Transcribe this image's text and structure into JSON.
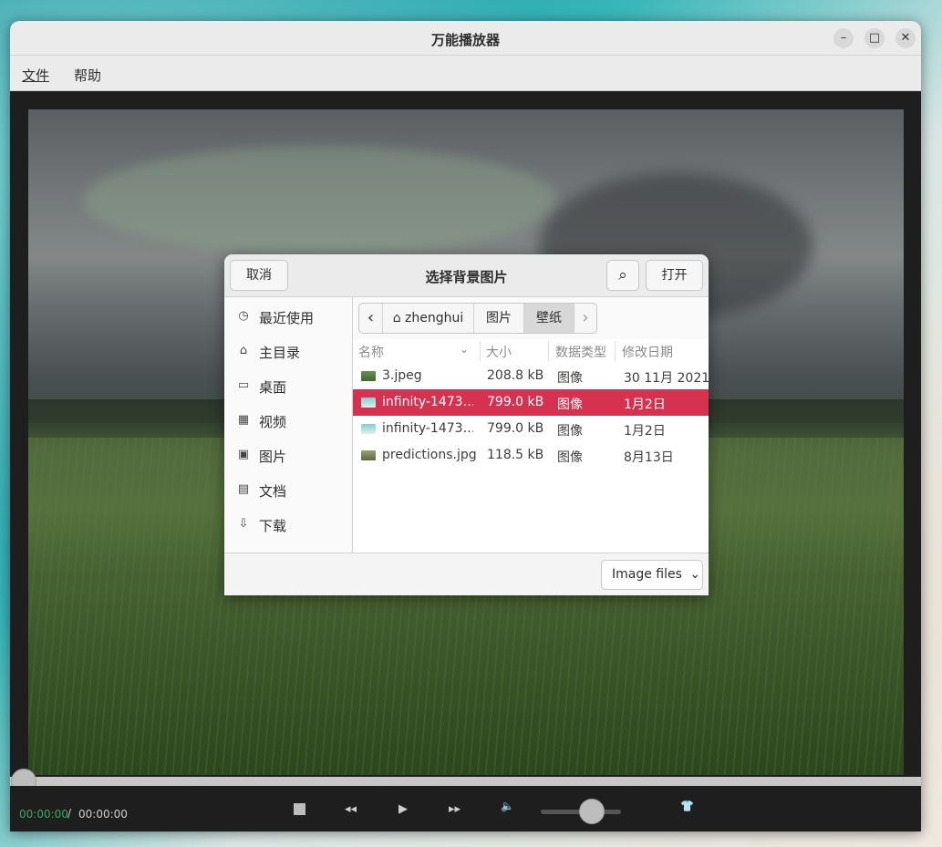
{
  "window": {
    "title": "万能播放器",
    "controls": {
      "minimize": "–",
      "maximize": "□",
      "close": "✕"
    }
  },
  "menu": {
    "file": "文件",
    "help": "帮助"
  },
  "player": {
    "current_time": "00:00:00",
    "separator": "/",
    "total_time": "00:00:00",
    "seek_fraction": 0.0,
    "volume_fraction": 0.5,
    "icons": {
      "stop": "stop-icon",
      "rewind": "rewind-icon",
      "play": "play-icon",
      "forward": "fast-forward-icon",
      "volume": "speaker-icon",
      "skin": "shirt-icon"
    },
    "glyphs": {
      "rewind": "◂◂",
      "play": "▶",
      "forward": "▸▸",
      "volume": "🔈",
      "skin": "👕"
    }
  },
  "dialog": {
    "title": "选择背景图片",
    "cancel_label": "取消",
    "open_label": "打开",
    "search_glyph": "⌕",
    "places": [
      {
        "label": "最近使用",
        "icon": "clock-icon",
        "glyph": "◷"
      },
      {
        "label": "主目录",
        "icon": "home-icon",
        "glyph": "⌂"
      },
      {
        "label": "桌面",
        "icon": "desktop-icon",
        "glyph": "▭"
      },
      {
        "label": "视频",
        "icon": "film-icon",
        "glyph": "▦"
      },
      {
        "label": "图片",
        "icon": "image-icon",
        "glyph": "▣"
      },
      {
        "label": "文档",
        "icon": "document-icon",
        "glyph": "▤"
      },
      {
        "label": "下载",
        "icon": "download-icon",
        "glyph": "⇩"
      }
    ],
    "path": {
      "back_glyph": "‹",
      "forward_glyph": "›",
      "home_glyph": "⌂",
      "segments": [
        "zhenghui",
        "图片",
        "壁纸"
      ]
    },
    "columns": {
      "name": "名称",
      "size": "大小",
      "type": "数据类型",
      "modified": "修改日期",
      "sort_glyph": "⌄"
    },
    "files": [
      {
        "name": "3.jpeg",
        "size": "208.8 kB",
        "type": "图像",
        "modified": "30 11月 2021",
        "selected": false
      },
      {
        "name": "infinity-1473…",
        "size": "799.0 kB",
        "type": "图像",
        "modified": "1月2日",
        "selected": true
      },
      {
        "name": "infinity-1473…",
        "size": "799.0 kB",
        "type": "图像",
        "modified": "1月2日",
        "selected": false
      },
      {
        "name": "predictions.jpg",
        "size": "118.5 kB",
        "type": "图像",
        "modified": "8月13日",
        "selected": false
      }
    ],
    "filter": {
      "label": "Image files",
      "chevron": "⌄"
    }
  },
  "colors": {
    "accent_selected": "#d6324f",
    "time_current": "#3aa86a"
  }
}
